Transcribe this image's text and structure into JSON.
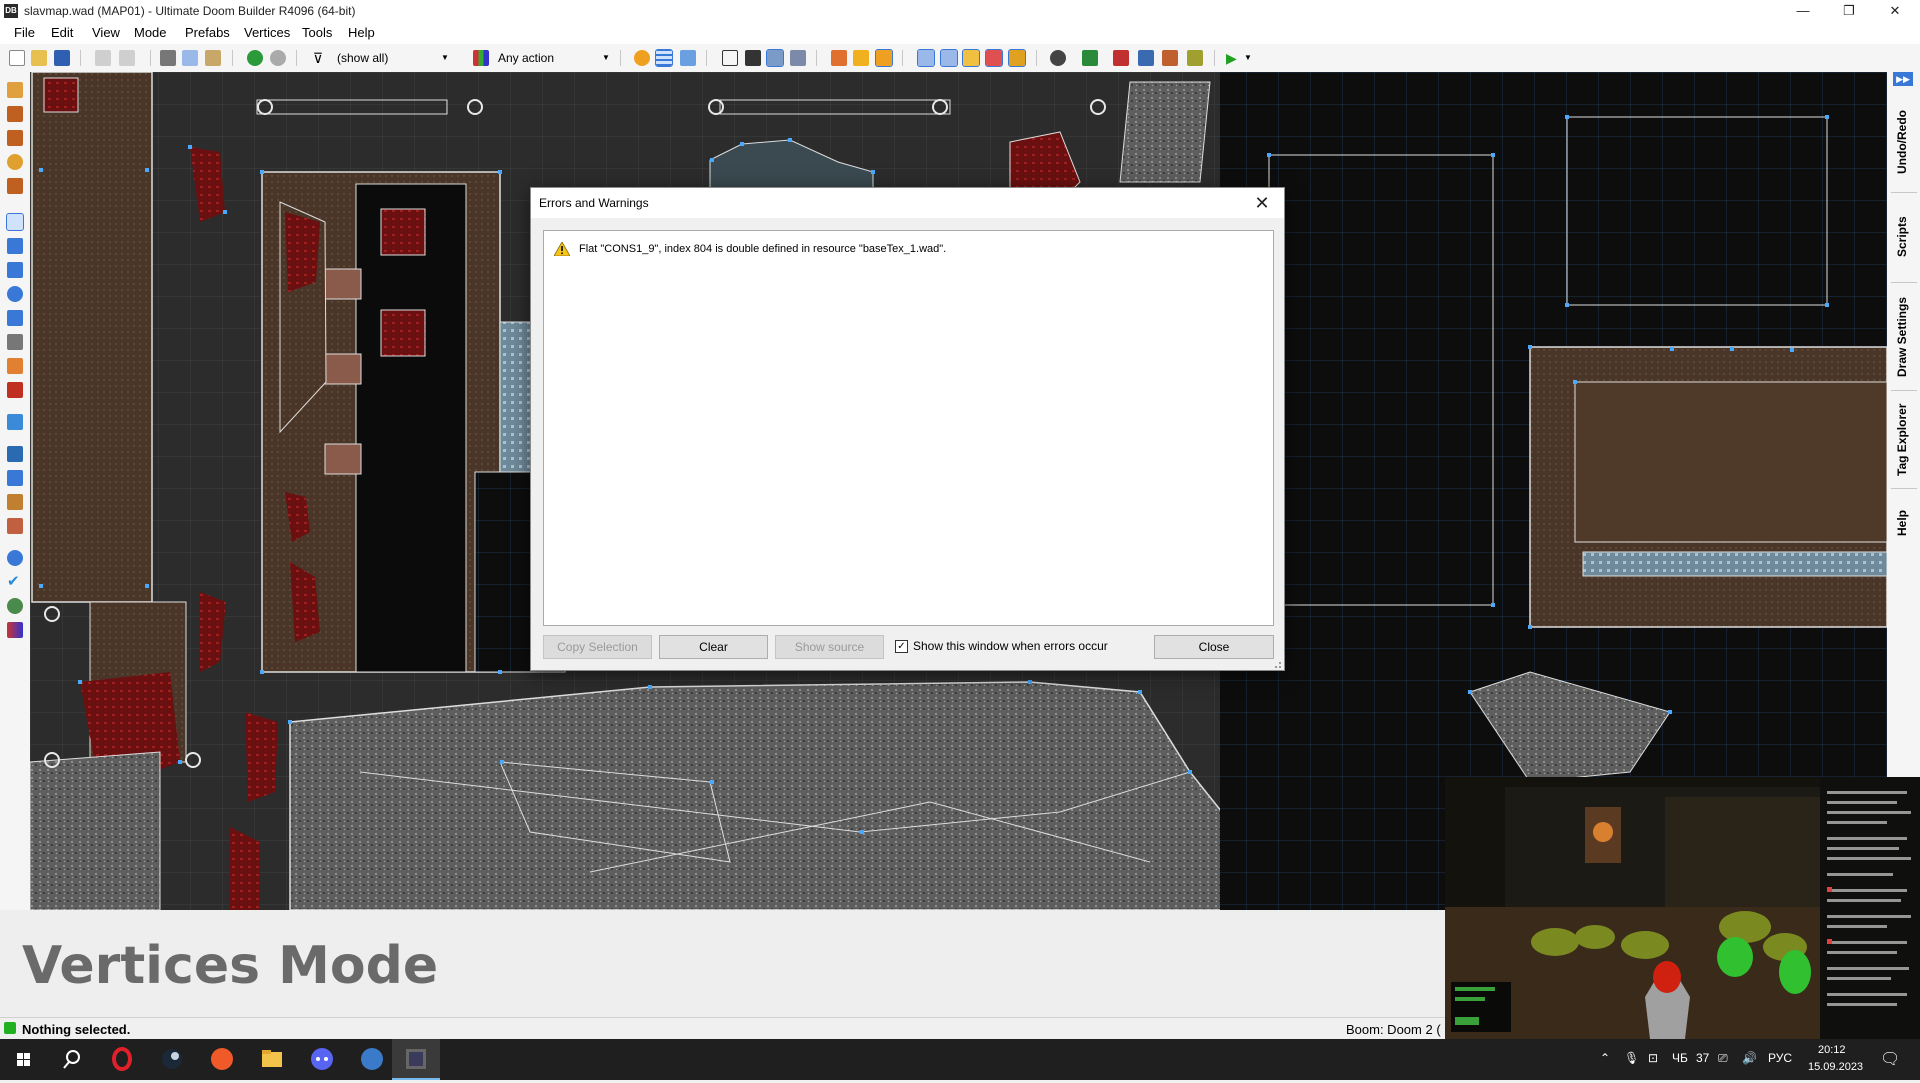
{
  "window": {
    "title": "slavmap.wad (MAP01) - Ultimate Doom Builder R4096 (64-bit)",
    "app_icon_text": "DB",
    "minimize": "—",
    "restore": "❐",
    "close": "✕"
  },
  "menu": [
    "File",
    "Edit",
    "View",
    "Mode",
    "Prefabs",
    "Vertices",
    "Tools",
    "Help"
  ],
  "toolbar": {
    "filter_value": "(show all)",
    "action_value": "Any action"
  },
  "right_tabs": [
    "Undo/Redo",
    "Scripts",
    "Draw Settings",
    "Tag Explorer",
    "Help"
  ],
  "dialog": {
    "title": "Errors and Warnings",
    "close_glyph": "✕",
    "errors": [
      {
        "level": "warning",
        "message": "Flat \"CONS1_9\", index 804 is double defined in resource \"baseTex_1.wad\"."
      }
    ],
    "buttons": {
      "copy_selection": "Copy Selection",
      "clear": "Clear",
      "show_source": "Show source",
      "close": "Close"
    },
    "show_on_errors_label": "Show this window when errors occur",
    "show_on_errors_checked": true
  },
  "mode_banner": "Vertices Mode",
  "status": {
    "text": "Nothing selected.",
    "game_config": "Boom: Doom 2 ("
  },
  "taskbar": {
    "tray_temp": "37",
    "tray_day": "ЧБ",
    "tray_lang": "РУС",
    "clock_time": "20:12",
    "clock_date": "15.09.2023"
  },
  "colors": {
    "vertex": "#4aa8ff",
    "linedef": "#d8d8d8",
    "warning": "#f5c518",
    "accent": "#3a78d8"
  }
}
